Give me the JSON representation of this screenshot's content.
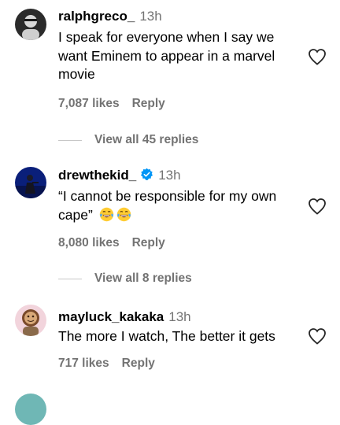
{
  "comments": [
    {
      "username": "ralphgreco_",
      "time": "13h",
      "verified": false,
      "text": "I speak for everyone when I say we want Eminem to appear in a marvel movie",
      "likes": "7,087 likes",
      "reply_label": "Reply",
      "view_replies": "View all 45 replies"
    },
    {
      "username": "drewthekid_",
      "time": "13h",
      "verified": true,
      "text": "“I cannot be responsible for my own cape”",
      "emoji": "face-with-tears-of-joy",
      "likes": "8,080 likes",
      "reply_label": "Reply",
      "view_replies": "View all 8 replies"
    },
    {
      "username": "mayluck_kakaka",
      "time": "13h",
      "verified": false,
      "text": "The more I watch, The better it gets",
      "likes": "717 likes",
      "reply_label": "Reply"
    }
  ],
  "colors": {
    "secondary_text": "#737373",
    "verified_badge": "#0095f6",
    "divider_line": "#c7c7c7"
  }
}
